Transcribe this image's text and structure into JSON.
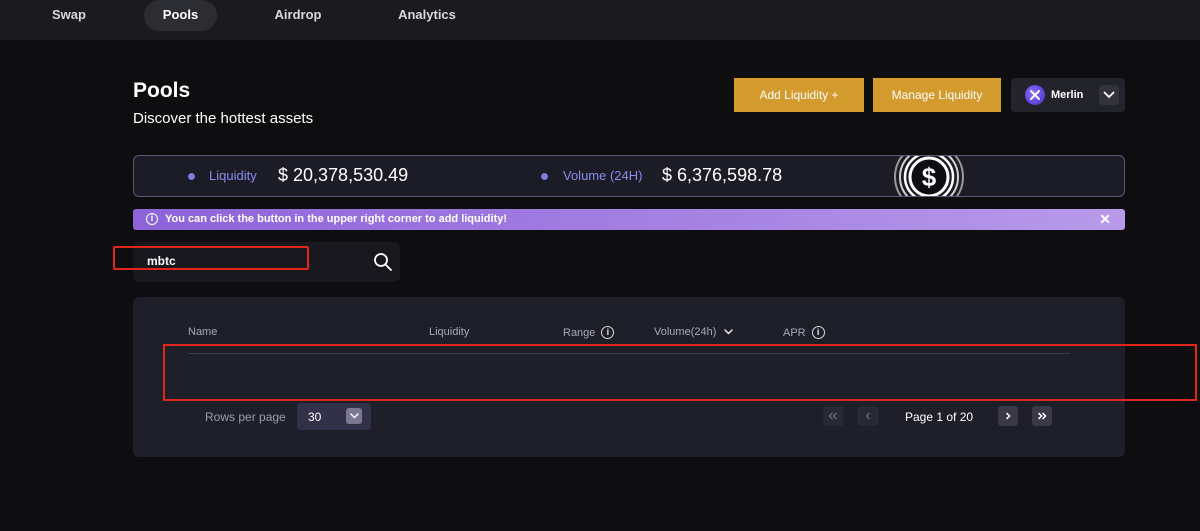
{
  "nav": {
    "tabs": [
      {
        "label": "Swap"
      },
      {
        "label": "Pools",
        "active": true
      },
      {
        "label": "Airdrop"
      },
      {
        "label": "Analytics"
      }
    ]
  },
  "header": {
    "title": "Pools",
    "subtitle": "Discover the hottest assets",
    "add_liquidity_label": "Add Liquidity +",
    "manage_liquidity_label": "Manage Liquidity",
    "chain": "Merlin"
  },
  "stats": {
    "liquidity_label": "Liquidity",
    "liquidity_value": "$ 20,378,530.49",
    "volume_label": "Volume (24H)",
    "volume_value": "$ 6,376,598.78"
  },
  "info_bar": {
    "text": "You can click the button in the upper right corner to add liquidity!"
  },
  "search": {
    "value": "mbtc",
    "placeholder": ""
  },
  "table": {
    "columns": {
      "name": "Name",
      "liquidity": "Liquidity",
      "range": "Range",
      "volume": "Volume(24h)",
      "apr": "APR"
    },
    "rows": []
  },
  "pagination": {
    "rows_per_page_label": "Rows per page",
    "rows_per_page": "30",
    "page_label": "Page 1 of 20",
    "current_page": 1,
    "total_pages": 20
  },
  "colors": {
    "accent_gold": "#d39a2d",
    "accent_purple": "#8a8cf0",
    "annotation_red": "#e0251b"
  }
}
